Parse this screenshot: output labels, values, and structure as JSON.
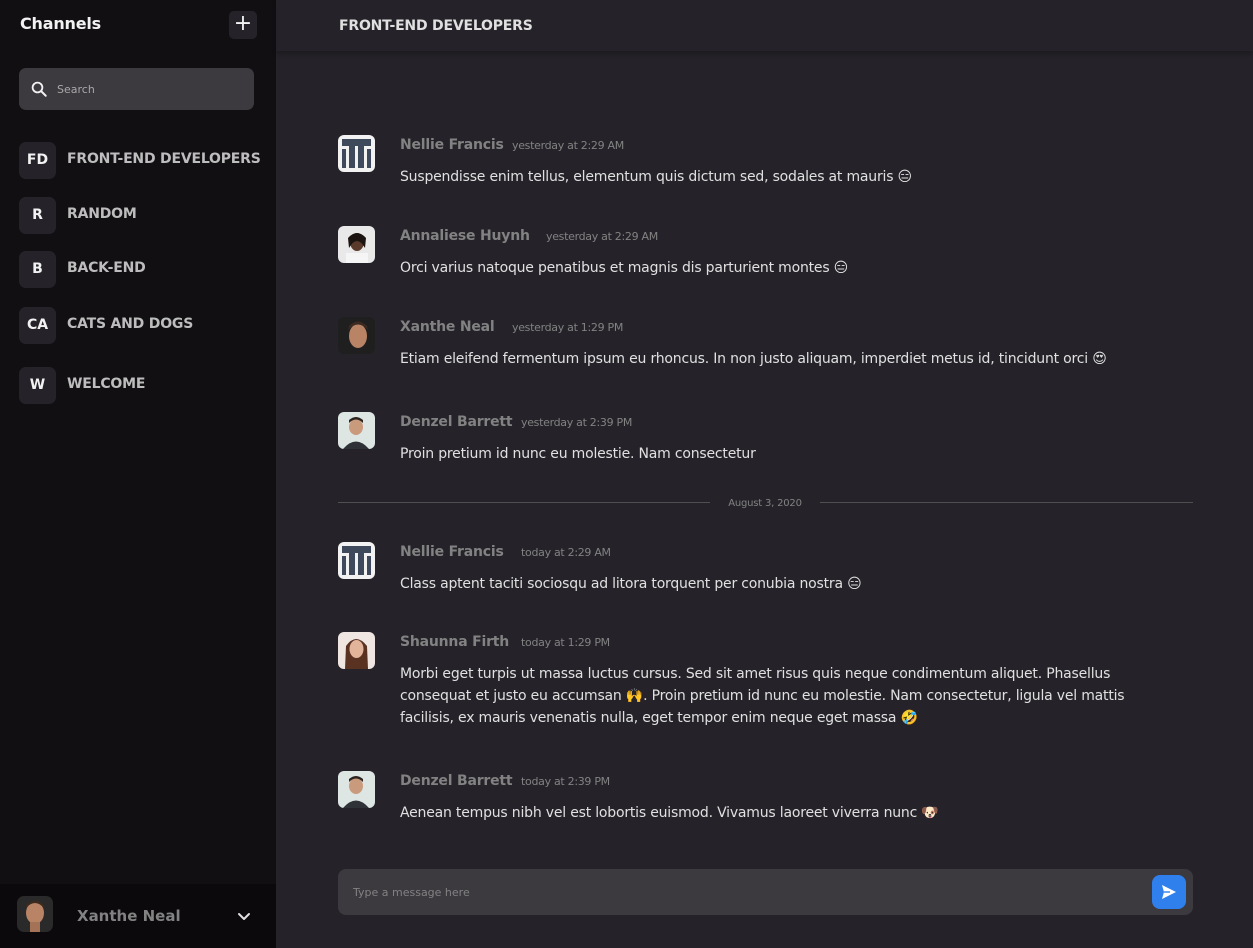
{
  "sidebar": {
    "title": "Channels",
    "add_label": "+",
    "search_placeholder": "Search",
    "channels": [
      {
        "abbr": "FD",
        "name": "FRONT-END DEVELOPERS"
      },
      {
        "abbr": "R",
        "name": "RANDOM"
      },
      {
        "abbr": "B",
        "name": "BACK-END"
      },
      {
        "abbr": "CA",
        "name": "CATS AND DOGS"
      },
      {
        "abbr": "W",
        "name": "WELCOME"
      }
    ],
    "profile": {
      "name": "Xanthe Neal"
    }
  },
  "channel_title": "FRONT-END DEVELOPERS",
  "messages": [
    {
      "author": "Nellie Francis",
      "time": "yesterday at 2:29 AM",
      "text": "Suspendisse enim tellus, elementum quis dictum sed, sodales at mauris 😑",
      "avatar": "logo"
    },
    {
      "author": "Annaliese Huynh",
      "time": "yesterday at 2:29 AM",
      "text": "Orci varius natoque penatibus et magnis dis parturient montes 😑",
      "avatar": "photo"
    },
    {
      "author": "Xanthe Neal",
      "time": "yesterday at 1:29 PM",
      "text": "Etiam eleifend fermentum ipsum eu rhoncus. In non justo aliquam, imperdiet metus id, tincidunt orci 😍",
      "avatar": "photo"
    },
    {
      "author": "Denzel Barrett",
      "time": "yesterday at 2:39 PM",
      "text": "Proin pretium id nunc eu molestie. Nam consectetur",
      "avatar": "photo"
    },
    {
      "author": "Nellie Francis",
      "time": "today at 2:29 AM",
      "text": "Class aptent taciti sociosqu ad litora torquent per conubia nostra 😑",
      "avatar": "logo"
    },
    {
      "author": "Shaunna Firth",
      "time": "today at 1:29 PM",
      "text": "Morbi eget turpis ut massa luctus cursus. Sed sit amet risus quis neque condimentum aliquet. Phasellus consequat et justo eu accumsan 🙌. Proin pretium id nunc eu molestie. Nam consectetur, ligula vel mattis facilisis, ex mauris venenatis nulla, eget tempor enim neque eget massa 🤣",
      "avatar": "photo"
    },
    {
      "author": "Denzel Barrett",
      "time": "today at 2:39 PM",
      "text": "Aenean tempus nibh vel est lobortis euismod. Vivamus laoreet viverra nunc 🐶",
      "avatar": "photo"
    }
  ],
  "date_divider": "August 3, 2020",
  "composer": {
    "placeholder": "Type a message here"
  },
  "colors": {
    "sidebar_bg": "#120F13",
    "main_bg": "#252329",
    "input_bg": "#3C393F",
    "accent": "#2F80ED"
  },
  "icons": {
    "search": "search-icon",
    "send": "send-icon",
    "chevron": "chevron-down-icon",
    "add": "plus-icon"
  }
}
